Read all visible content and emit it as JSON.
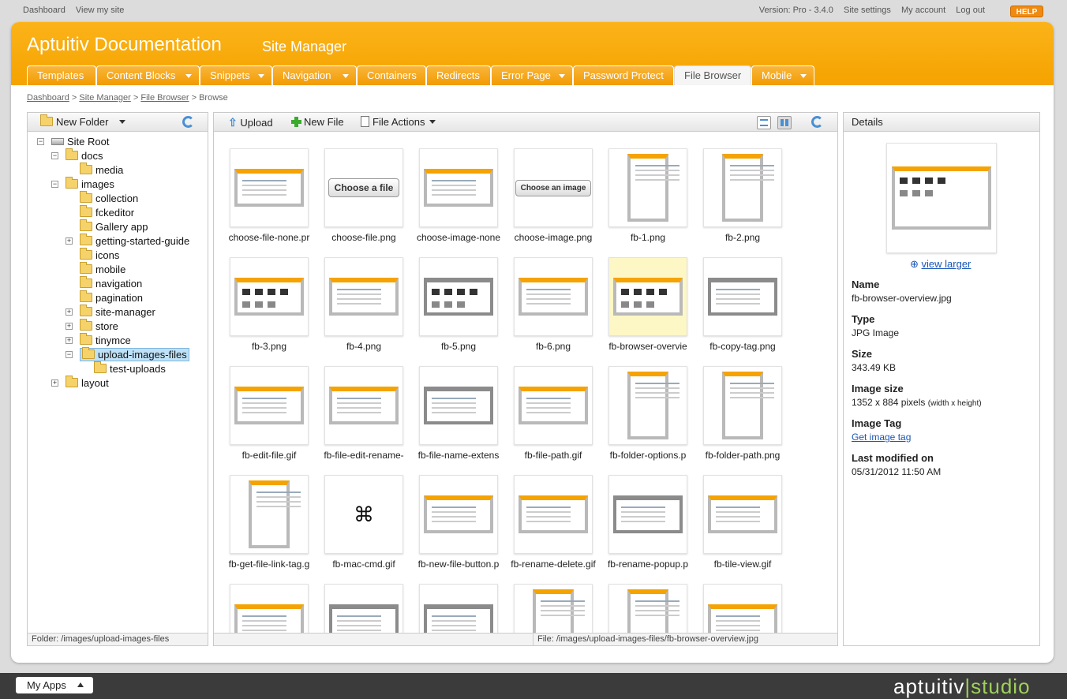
{
  "topbar": {
    "left_links": [
      "Dashboard",
      "View my site"
    ],
    "version": "Version: Pro - 3.4.0",
    "right_links": [
      "Site settings",
      "My account",
      "Log out"
    ],
    "help": "HELP"
  },
  "header": {
    "app_title": "Aptuitiv Documentation",
    "section_title": "Site Manager"
  },
  "tabs": [
    {
      "label": "Templates",
      "dropdown": false,
      "active": false
    },
    {
      "label": "Content Blocks",
      "dropdown": true,
      "active": false
    },
    {
      "label": "Snippets",
      "dropdown": true,
      "active": false
    },
    {
      "label": "Navigation",
      "dropdown": true,
      "active": false
    },
    {
      "label": "Containers",
      "dropdown": false,
      "active": false
    },
    {
      "label": "Redirects",
      "dropdown": false,
      "active": false
    },
    {
      "label": "Error Page",
      "dropdown": true,
      "active": false
    },
    {
      "label": "Password Protect",
      "dropdown": false,
      "active": false
    },
    {
      "label": "File Browser",
      "dropdown": false,
      "active": true
    },
    {
      "label": "Mobile",
      "dropdown": true,
      "active": false
    }
  ],
  "breadcrumb": {
    "items": [
      "Dashboard",
      "Site Manager",
      "File Browser"
    ],
    "current": "Browse",
    "separator": ">"
  },
  "left_panel": {
    "new_folder": "New Folder",
    "tree": [
      {
        "label": "Site Root",
        "toggle": "minus",
        "type": "drive"
      },
      {
        "label": "docs",
        "toggle": "minus"
      },
      {
        "label": "media",
        "toggle": ""
      },
      {
        "label": "images",
        "toggle": "minus"
      },
      {
        "label": "collection",
        "toggle": ""
      },
      {
        "label": "fckeditor",
        "toggle": ""
      },
      {
        "label": "Gallery app",
        "toggle": ""
      },
      {
        "label": "getting-started-guide",
        "toggle": "plus"
      },
      {
        "label": "icons",
        "toggle": ""
      },
      {
        "label": "mobile",
        "toggle": ""
      },
      {
        "label": "navigation",
        "toggle": ""
      },
      {
        "label": "pagination",
        "toggle": ""
      },
      {
        "label": "site-manager",
        "toggle": "plus"
      },
      {
        "label": "store",
        "toggle": "plus"
      },
      {
        "label": "tinymce",
        "toggle": "plus"
      },
      {
        "label": "upload-images-files",
        "toggle": "minus",
        "selected": true
      },
      {
        "label": "test-uploads",
        "toggle": ""
      },
      {
        "label": "layout",
        "toggle": "plus"
      }
    ],
    "status": "Folder:  /images/upload-images-files"
  },
  "middle_panel": {
    "upload": "Upload",
    "new_file": "New File",
    "file_actions": "File Actions",
    "files": [
      {
        "name": "choose-file-none.pr",
        "kind": "shot"
      },
      {
        "name": "choose-file.png",
        "kind": "button",
        "text": "Choose a file"
      },
      {
        "name": "choose-image-none",
        "kind": "shot"
      },
      {
        "name": "choose-image.png",
        "kind": "button-small",
        "text": "Choose an image"
      },
      {
        "name": "fb-1.png",
        "kind": "tall"
      },
      {
        "name": "fb-2.png",
        "kind": "tall"
      },
      {
        "name": "fb-3.png",
        "kind": "grid"
      },
      {
        "name": "fb-4.png",
        "kind": "shot"
      },
      {
        "name": "fb-5.png",
        "kind": "grid-gray"
      },
      {
        "name": "fb-6.png",
        "kind": "shot"
      },
      {
        "name": "fb-browser-overvie",
        "kind": "grid",
        "highlight": true
      },
      {
        "name": "fb-copy-tag.png",
        "kind": "gray"
      },
      {
        "name": "fb-edit-file.gif",
        "kind": "shot"
      },
      {
        "name": "fb-file-edit-rename-",
        "kind": "shot"
      },
      {
        "name": "fb-file-name-extens",
        "kind": "gray"
      },
      {
        "name": "fb-file-path.gif",
        "kind": "shot"
      },
      {
        "name": "fb-folder-options.p",
        "kind": "tall"
      },
      {
        "name": "fb-folder-path.png",
        "kind": "tall"
      },
      {
        "name": "fb-get-file-link-tag.g",
        "kind": "tall"
      },
      {
        "name": "fb-mac-cmd.gif",
        "kind": "glyph",
        "text": "⌘"
      },
      {
        "name": "fb-new-file-button.p",
        "kind": "shot"
      },
      {
        "name": "fb-rename-delete.gif",
        "kind": "shot"
      },
      {
        "name": "fb-rename-popup.p",
        "kind": "gray"
      },
      {
        "name": "fb-tile-view.gif",
        "kind": "shot"
      },
      {
        "name": "",
        "kind": "shot"
      },
      {
        "name": "",
        "kind": "gray"
      },
      {
        "name": "",
        "kind": "gray"
      },
      {
        "name": "",
        "kind": "tall"
      },
      {
        "name": "",
        "kind": "tall"
      },
      {
        "name": "",
        "kind": "shot"
      }
    ],
    "status": "File:  /images/upload-images-files/fb-browser-overview.jpg"
  },
  "details": {
    "title": "Details",
    "view_larger": "view larger",
    "name_label": "Name",
    "name_value": "fb-browser-overview.jpg",
    "type_label": "Type",
    "type_value": "JPG Image",
    "size_label": "Size",
    "size_value": "343.49 KB",
    "imgsize_label": "Image size",
    "imgsize_value": "1352 x 884 pixels",
    "imgsize_note": "(width x height)",
    "tag_label": "Image Tag",
    "tag_link": "Get image tag",
    "modified_label": "Last modified on",
    "modified_value": "05/31/2012 11:50 AM"
  },
  "bottom": {
    "my_apps": "My Apps",
    "brand_main": "aptuitiv",
    "brand_sep": "|",
    "brand_sub": "studio"
  },
  "colors": {
    "accent": "#f5a300",
    "link": "#1a56b8",
    "selection": "#bfe1f7"
  }
}
